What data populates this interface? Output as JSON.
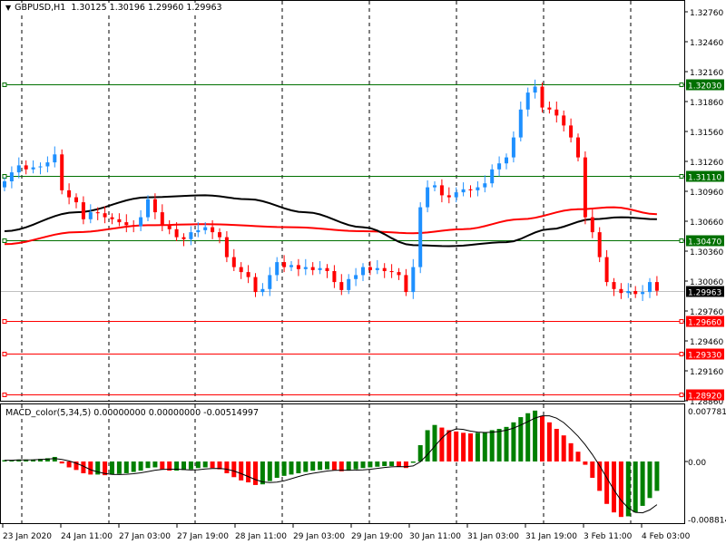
{
  "header": {
    "symbol": "GBPUSD,H1",
    "open": "1.30125",
    "high": "1.30196",
    "low": "1.29960",
    "close": "1.29963"
  },
  "indicator": {
    "label": "MACD_color(5,34,5) 0.00000000 0.00000000 -0.00514997"
  },
  "chart_data": {
    "type": "candlestick",
    "title": "GBPUSD,H1",
    "price_axis": {
      "ticks": [
        "1.32760",
        "1.32460",
        "1.32160",
        "1.31860",
        "1.31560",
        "1.31260",
        "1.30960",
        "1.30660",
        "1.30360",
        "1.30060",
        "1.29760",
        "1.29460",
        "1.29160",
        "1.28860"
      ],
      "range": [
        1.2886,
        1.3276
      ]
    },
    "time_axis": {
      "ticks": [
        "23 Jan 2020",
        "24 Jan 11:00",
        "27 Jan 03:00",
        "27 Jan 19:00",
        "28 Jan 11:00",
        "29 Jan 03:00",
        "29 Jan 19:00",
        "30 Jan 11:00",
        "31 Jan 03:00",
        "31 Jan 19:00",
        "3 Feb 11:00",
        "4 Feb 03:00"
      ]
    },
    "closes": [
      1.3106,
      1.3115,
      1.3122,
      1.3118,
      1.312,
      1.3121,
      1.3125,
      1.3133,
      1.3097,
      1.309,
      1.3085,
      1.3068,
      1.3075,
      1.3074,
      1.307,
      1.3068,
      1.3065,
      1.3062,
      1.3061,
      1.307,
      1.3088,
      1.3075,
      1.3062,
      1.3058,
      1.305,
      1.3048,
      1.3055,
      1.3057,
      1.306,
      1.3055,
      1.305,
      1.303,
      1.302,
      1.3015,
      1.301,
      1.2995,
      1.2998,
      1.3012,
      1.3025,
      1.302,
      1.3022,
      1.3018,
      1.302,
      1.3017,
      1.3019,
      1.3016,
      1.3005,
      1.2997,
      1.3008,
      1.3012,
      1.302,
      1.3017,
      1.3019,
      1.3016,
      1.3015,
      1.3012,
      1.2995,
      1.302,
      1.308,
      1.31,
      1.3102,
      1.3092,
      1.309,
      1.3095,
      1.3098,
      1.3097,
      1.31,
      1.3104,
      1.3118,
      1.3124,
      1.313,
      1.315,
      1.3178,
      1.3195,
      1.3201,
      1.318,
      1.3178,
      1.3172,
      1.3162,
      1.315,
      1.313,
      1.307,
      1.3055,
      1.303,
      1.3005,
      1.2998,
      1.2994,
      1.2996,
      1.2993,
      1.2995,
      1.3005,
      1.29963
    ],
    "first_open": 1.31,
    "ma_black": [
      [
        0,
        1.3056
      ],
      [
        10,
        1.3075
      ],
      [
        20,
        1.309
      ],
      [
        28,
        1.3092
      ],
      [
        34,
        1.3088
      ],
      [
        42,
        1.3075
      ],
      [
        50,
        1.306
      ],
      [
        57,
        1.3042
      ],
      [
        62,
        1.3041
      ],
      [
        70,
        1.3045
      ],
      [
        76,
        1.3058
      ],
      [
        82,
        1.3068
      ],
      [
        86,
        1.307
      ],
      [
        91,
        1.3068
      ]
    ],
    "ma_red": [
      [
        0,
        1.3043
      ],
      [
        10,
        1.3055
      ],
      [
        20,
        1.3062
      ],
      [
        28,
        1.3063
      ],
      [
        40,
        1.306
      ],
      [
        50,
        1.3056
      ],
      [
        57,
        1.3054
      ],
      [
        64,
        1.3058
      ],
      [
        72,
        1.3068
      ],
      [
        80,
        1.3078
      ],
      [
        85,
        1.308
      ],
      [
        91,
        1.3073
      ]
    ],
    "levels": [
      {
        "price": "1.32030",
        "color": "#007000"
      },
      {
        "price": "1.31110",
        "color": "#007000"
      },
      {
        "price": "1.30470",
        "color": "#007000"
      },
      {
        "price": "1.29660",
        "color": "#ff0000"
      },
      {
        "price": "1.29330",
        "color": "#ff0000"
      },
      {
        "price": "1.28920",
        "color": "#ff0000"
      }
    ],
    "current_price": "1.29963",
    "macd": {
      "ticks": [
        "0.0077812",
        "0.00",
        "-0.0088146"
      ],
      "range": [
        -0.0088146,
        0.0077812
      ],
      "values_e3": [
        0.2,
        0.2,
        0.3,
        0.3,
        0.3,
        0.4,
        0.5,
        0.7,
        -0.3,
        -0.9,
        -1.3,
        -1.8,
        -2.0,
        -2.0,
        -2.1,
        -2.0,
        -1.9,
        -1.8,
        -1.6,
        -1.4,
        -1.0,
        -0.9,
        -1.2,
        -1.4,
        -1.4,
        -1.3,
        -1.2,
        -1.0,
        -0.9,
        -1.0,
        -1.2,
        -1.8,
        -2.4,
        -2.9,
        -3.2,
        -3.6,
        -3.5,
        -3.0,
        -2.5,
        -2.2,
        -2.0,
        -1.8,
        -1.6,
        -1.4,
        -1.3,
        -1.2,
        -1.3,
        -1.5,
        -1.4,
        -1.2,
        -1.0,
        -0.9,
        -0.8,
        -0.7,
        -0.7,
        -0.8,
        -1.0,
        -0.2,
        2.5,
        4.8,
        5.6,
        5.2,
        4.8,
        4.6,
        4.4,
        4.3,
        4.4,
        4.5,
        4.8,
        5.0,
        5.3,
        6.0,
        6.8,
        7.4,
        7.8,
        7.0,
        6.0,
        5.0,
        4.0,
        2.8,
        1.5,
        -0.5,
        -2.5,
        -4.5,
        -6.5,
        -7.8,
        -8.5,
        -8.4,
        -7.8,
        -6.8,
        -5.6,
        -4.5
      ]
    },
    "colors": {
      "up": "#1e90ff",
      "down": "#ff0000",
      "macd_up": "#008000",
      "macd_down": "#ff0000",
      "level_green": "#007000",
      "level_red": "#ff0000"
    }
  }
}
